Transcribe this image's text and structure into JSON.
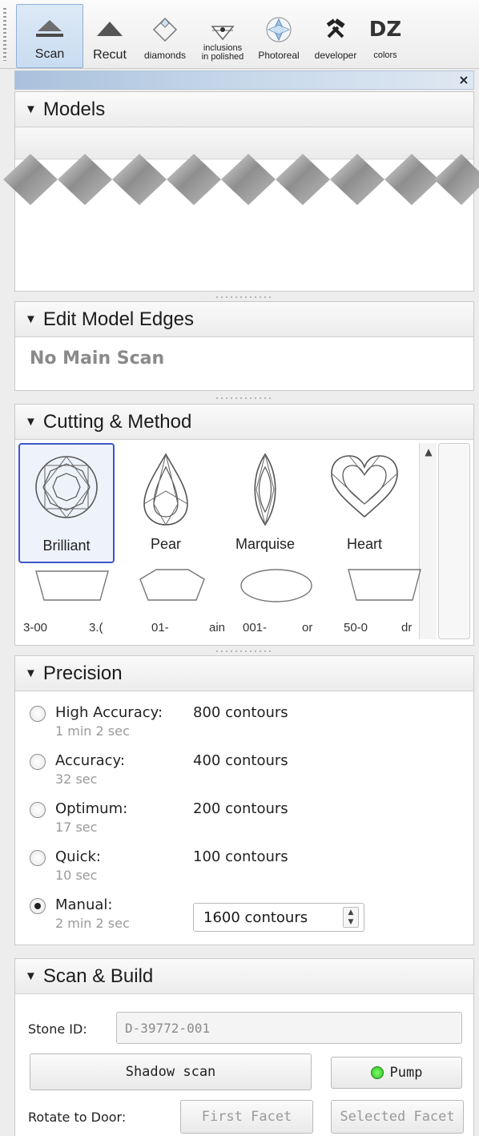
{
  "toolbar": {
    "tools": [
      {
        "label": "Scan"
      },
      {
        "label": "Recut"
      },
      {
        "label": "diamonds"
      },
      {
        "label_line1": "inclusions",
        "label_line2": "in polished"
      },
      {
        "label": "Photoreal"
      },
      {
        "label": "developer"
      },
      {
        "label": "colors",
        "logo": "DZ"
      }
    ]
  },
  "window": {
    "close": "×"
  },
  "models": {
    "title": "Models"
  },
  "edit_edges": {
    "title": "Edit Model Edges",
    "status": "No Main Scan"
  },
  "cutting": {
    "title": "Cutting & Method",
    "shapes": [
      {
        "name": "Brilliant",
        "selected": true
      },
      {
        "name": "Pear"
      },
      {
        "name": "Marquise"
      },
      {
        "name": "Heart"
      }
    ],
    "row2_labels": [
      "3-00",
      "3.(",
      "01-",
      "ain",
      "001-",
      "or",
      "50-0",
      "dr"
    ]
  },
  "precision": {
    "title": "Precision",
    "options": [
      {
        "name": "High Accuracy:",
        "time": "1 min 2 sec",
        "value": "800 contours",
        "selected": false
      },
      {
        "name": "Accuracy:",
        "time": "32 sec",
        "value": "400 contours",
        "selected": false
      },
      {
        "name": "Optimum:",
        "time": "17 sec",
        "value": "200 contours",
        "selected": false
      },
      {
        "name": "Quick:",
        "time": "10 sec",
        "value": "100 contours",
        "selected": false
      },
      {
        "name": "Manual:",
        "time": "2 min 2 sec",
        "value": "1600 contours",
        "selected": true
      }
    ]
  },
  "scan_build": {
    "title": "Scan & Build",
    "stone_id_label": "Stone ID:",
    "stone_id_value": "D-39772-001",
    "shadow_scan": "Shadow scan",
    "pump": "Pump",
    "rotate_label": "Rotate to Door:",
    "first_facet": "First Facet",
    "selected_facet": "Selected Facet"
  },
  "colors": {
    "accent": "#3d57c8",
    "pump_led": "#2bbf1e",
    "title_bar": "#a9c1dc"
  }
}
